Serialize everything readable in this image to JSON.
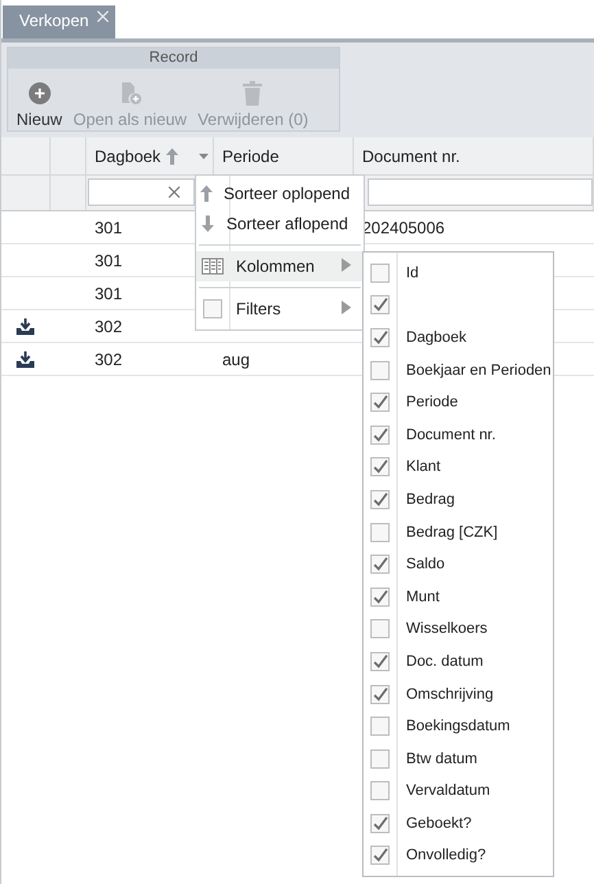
{
  "tab": {
    "label": "Verkopen"
  },
  "toolbar": {
    "group": "Record",
    "buttons": [
      {
        "label": "Nieuw",
        "kind": "add",
        "disabled": false
      },
      {
        "label": "Open als nieuw",
        "kind": "copy",
        "disabled": true
      },
      {
        "label": "Verwijderen (0)",
        "kind": "delete",
        "disabled": true
      }
    ]
  },
  "grid": {
    "columns": [
      {
        "label": "Dagboek",
        "sorted": true
      },
      {
        "label": "Periode",
        "sorted": false
      },
      {
        "label": "Document nr.",
        "sorted": false
      }
    ],
    "rows": [
      {
        "kind": "plain",
        "dagboek": "301",
        "document": "202405006"
      },
      {
        "kind": "plain",
        "dagboek": "301"
      },
      {
        "kind": "plain",
        "dagboek": "301"
      },
      {
        "kind": "download",
        "dagboek": "302"
      },
      {
        "kind": "download",
        "dagboek": "302",
        "periode": "aug"
      }
    ]
  },
  "column_menu": {
    "items": [
      {
        "kind": "ascending",
        "label": "Sorteer oplopend",
        "selected": false
      },
      {
        "kind": "descending",
        "label": "Sorteer aflopend",
        "selected": false
      },
      {
        "kind": "columns",
        "label": "Kolommen",
        "selected": true
      },
      {
        "kind": "check",
        "label": "Filters",
        "checked": false,
        "selected": false
      }
    ]
  },
  "columns_menu": {
    "items": [
      {
        "label": "Id",
        "checked": false
      },
      {
        "checked": true
      },
      {
        "label": "Dagboek",
        "checked": true
      },
      {
        "label": "Boekjaar en Perioden",
        "checked": false
      },
      {
        "label": "Periode",
        "checked": true
      },
      {
        "label": "Document nr.",
        "checked": true
      },
      {
        "label": "Klant",
        "checked": true
      },
      {
        "label": "Bedrag",
        "checked": true
      },
      {
        "label": "Bedrag [CZK]",
        "checked": false
      },
      {
        "label": "Saldo",
        "checked": true
      },
      {
        "label": "Munt",
        "checked": true
      },
      {
        "label": "Wisselkoers",
        "checked": false
      },
      {
        "label": "Doc. datum",
        "checked": true
      },
      {
        "label": "Omschrijving",
        "checked": true
      },
      {
        "label": "Boekingsdatum",
        "checked": false
      },
      {
        "label": "Btw datum",
        "checked": false
      },
      {
        "label": "Vervaldatum",
        "checked": false
      },
      {
        "label": "Geboekt?",
        "checked": true
      },
      {
        "label": "Onvolledig?",
        "checked": true
      }
    ]
  }
}
